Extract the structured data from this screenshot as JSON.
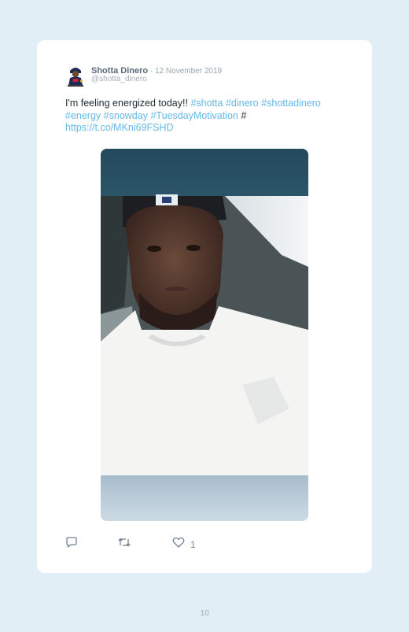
{
  "tweet": {
    "display_name": "Shotta Dinero",
    "separator": " · ",
    "date": "12 November 2019",
    "handle": "@shotta_dinero",
    "text_plain_1": "I'm feeling energized today!! ",
    "hashtags_line1": [
      "#shotta",
      "#dinero",
      "#shottadinero"
    ],
    "hashtags_line2": [
      "#energy",
      "#snowday",
      "#TuesdayMotivation"
    ],
    "trailing_hash": " #",
    "link": "https://t.co/MKni69FSHD",
    "like_count": "1",
    "icons": {
      "reply": "reply-icon",
      "retweet": "retweet-icon",
      "like": "heart-icon",
      "avatar": "avatar"
    }
  },
  "page": {
    "number": "10"
  },
  "colors": {
    "background": "#e2eef6",
    "card": "#ffffff",
    "link": "#66b9e8",
    "text": "#1f2a33",
    "muted": "#9aa6b0"
  }
}
